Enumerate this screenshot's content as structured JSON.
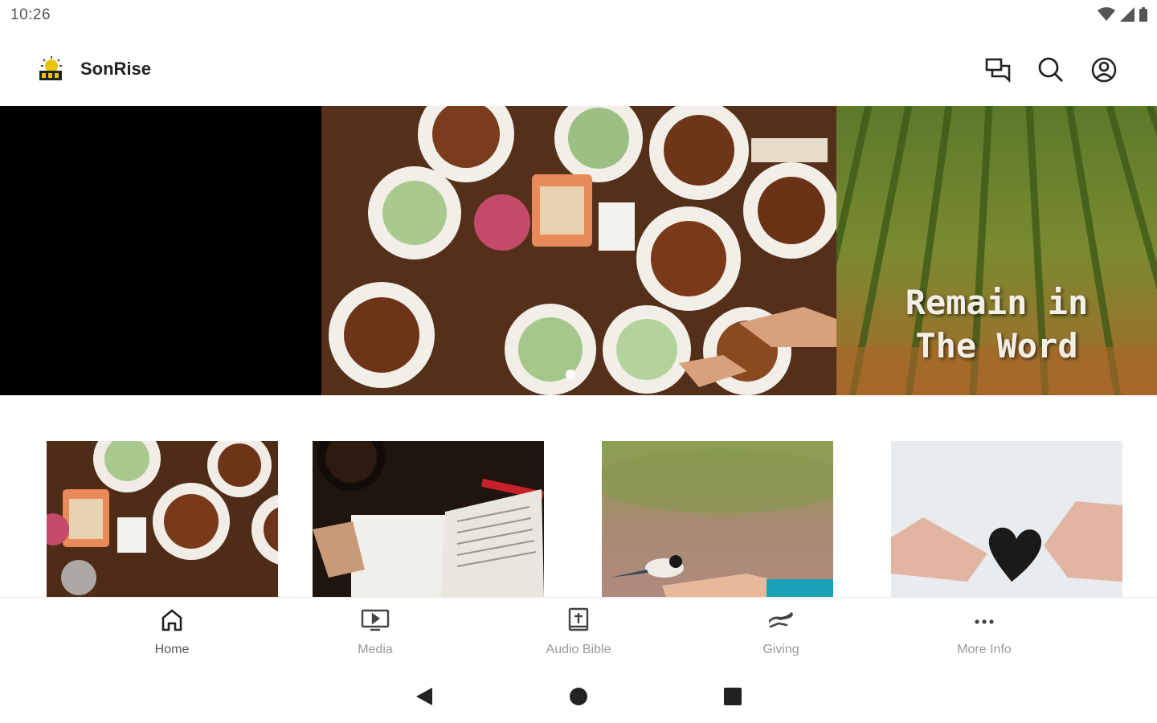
{
  "status_bar": {
    "time": "10:26"
  },
  "app": {
    "title": "SonRise"
  },
  "header": {
    "icons": [
      "chat-icon",
      "search-icon",
      "account-icon"
    ]
  },
  "hero": {
    "slides": [
      {
        "caption": ""
      },
      {
        "caption": ""
      },
      {
        "caption": "Remain in\nThe Word"
      }
    ],
    "active_index": 1
  },
  "cards": [
    {
      "image": "food-table-photo"
    },
    {
      "image": "bible-notebook-photo"
    },
    {
      "image": "bird-hand-photo"
    },
    {
      "image": "heart-hands-photo"
    }
  ],
  "bottom_nav": {
    "items": [
      {
        "label": "Home",
        "icon": "home-icon",
        "active": true
      },
      {
        "label": "Media",
        "icon": "media-icon",
        "active": false
      },
      {
        "label": "Audio Bible",
        "icon": "bible-icon",
        "active": false
      },
      {
        "label": "Giving",
        "icon": "giving-icon",
        "active": false
      },
      {
        "label": "More Info",
        "icon": "more-icon",
        "active": false
      }
    ]
  },
  "colors": {
    "label_active": "#555555",
    "label_inactive": "#9a9a9a",
    "icon": "#222222"
  }
}
